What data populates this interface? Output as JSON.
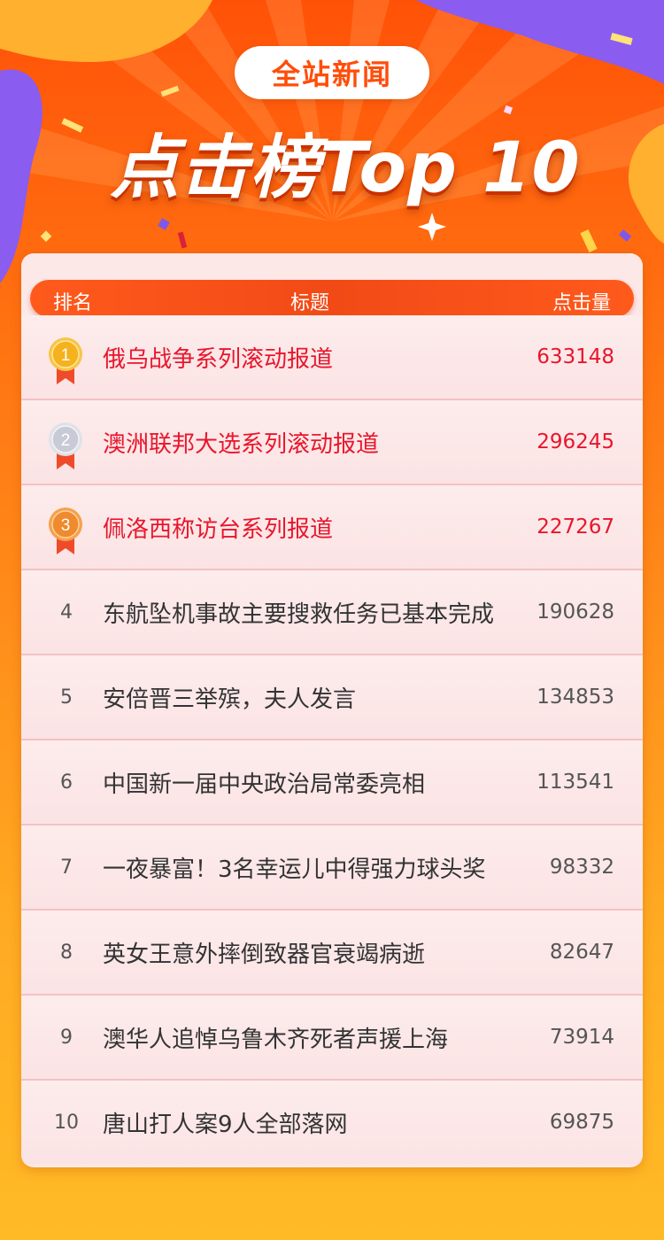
{
  "header": {
    "badge": "全站新闻",
    "title": "点击榜Top 10"
  },
  "table": {
    "columns": {
      "rank": "排名",
      "title": "标题",
      "clicks": "点击量"
    },
    "rows": [
      {
        "rank": "1",
        "title": "俄乌战争系列滚动报道",
        "clicks": "633148",
        "medal": "gold-medal-icon"
      },
      {
        "rank": "2",
        "title": "澳洲联邦大选系列滚动报道",
        "clicks": "296245",
        "medal": "silver-medal-icon"
      },
      {
        "rank": "3",
        "title": "佩洛西称访台系列报道",
        "clicks": "227267",
        "medal": "bronze-medal-icon"
      },
      {
        "rank": "4",
        "title": "东航坠机事故主要搜救任务已基本完成",
        "clicks": "190628"
      },
      {
        "rank": "5",
        "title": "安倍晋三举殡，夫人发言",
        "clicks": "134853"
      },
      {
        "rank": "6",
        "title": "中国新一届中央政治局常委亮相",
        "clicks": "113541"
      },
      {
        "rank": "7",
        "title": "一夜暴富！3名幸运儿中得强力球头奖",
        "clicks": "98332"
      },
      {
        "rank": "8",
        "title": "英女王意外摔倒致器官衰竭病逝",
        "clicks": "82647"
      },
      {
        "rank": "9",
        "title": "澳华人追悼乌鲁木齐死者声援上海",
        "clicks": "73914"
      },
      {
        "rank": "10",
        "title": "唐山打人案9人全部落网",
        "clicks": "69875"
      }
    ]
  },
  "colors": {
    "accent_red": "#e8162c",
    "header_orange": "#ff5208",
    "gold": "#f5b21e",
    "silver": "#c8cbd6",
    "bronze": "#f08a2c"
  }
}
